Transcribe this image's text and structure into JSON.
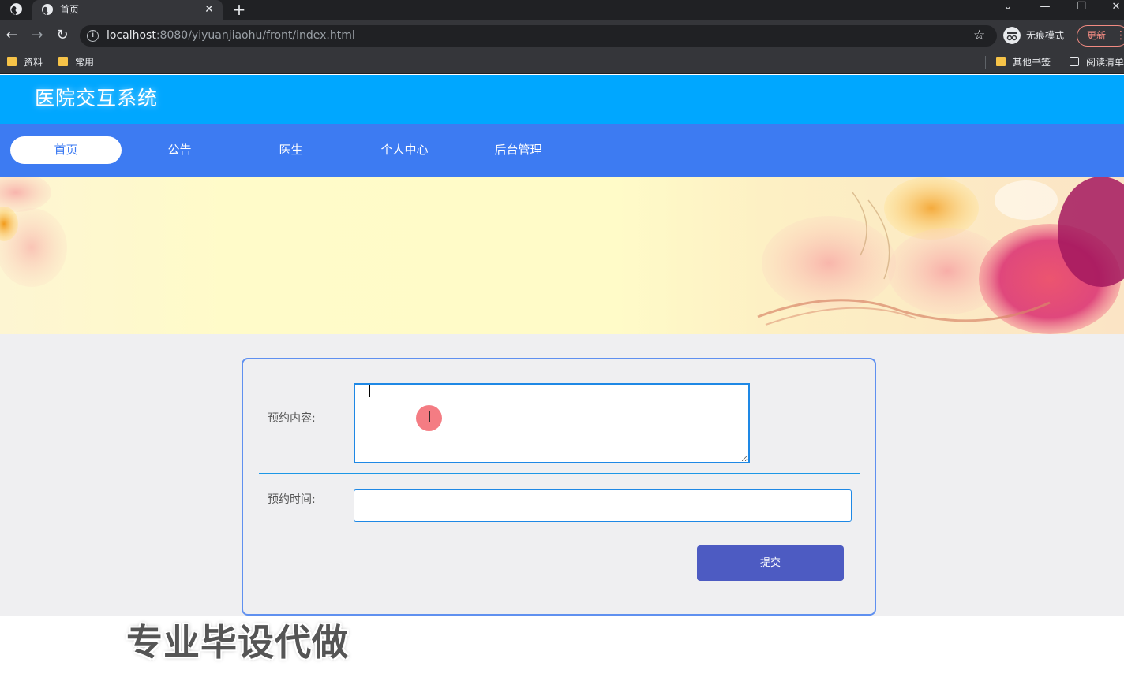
{
  "browser": {
    "tab_title": "首页",
    "tab_close": "✕",
    "new_tab": "+",
    "url_host": "localhost",
    "url_rest": ":8080/yiyuanjiaohu/front/index.html",
    "incognito_label": "无痕模式",
    "update_label": "更新",
    "bookmarks": [
      "资料",
      "常用"
    ],
    "bookmarks_right": [
      "其他书签",
      "阅读清单"
    ]
  },
  "site": {
    "title": "医院交互系统",
    "nav": [
      "首页",
      "公告",
      "医生",
      "个人中心",
      "后台管理"
    ],
    "active_nav": 0
  },
  "banner": {
    "slide_count": 3,
    "active_slide": 0
  },
  "form": {
    "content_label": "预约内容:",
    "content_value": "",
    "time_label": "预约时间:",
    "time_value": "",
    "submit_label": "提交"
  },
  "watermark": "专业毕设代做",
  "colors": {
    "header": "#00a7ff",
    "navbar": "#3d7bf2",
    "submit": "#4d5bc2",
    "divider": "#1c97e6"
  }
}
